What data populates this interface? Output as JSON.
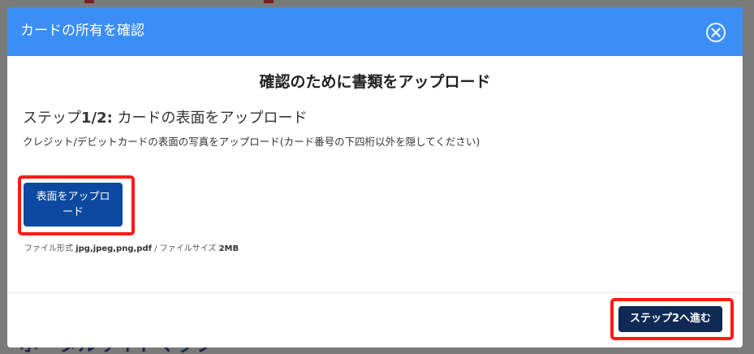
{
  "background": {
    "heading": "ポータルサイトマップ"
  },
  "modal": {
    "title": "カードの所有を確認",
    "close_icon": "close-circle-icon",
    "section_title": "確認のために書類をアップロード",
    "step": {
      "prefix": "ステップ",
      "number": "1/2:",
      "label": " カードの表面をアップロード",
      "description": "クレジット/デビットカードの表面の写真をアップロード(カード番号の下四桁以外を隠してください)"
    },
    "upload_button": "表面をアップロード",
    "file_info": {
      "format_label": "ファイル形式 ",
      "formats": "jpg,jpeg,png,pdf",
      "separator": " / ",
      "size_label": "ファイルサイズ ",
      "size": "2MB"
    },
    "next_button": "ステップ2へ進む"
  },
  "colors": {
    "header": "#3a8ef6",
    "upload_button": "#0b4aa0",
    "next_button": "#0e2a55",
    "highlight": "#ff1a1a"
  }
}
